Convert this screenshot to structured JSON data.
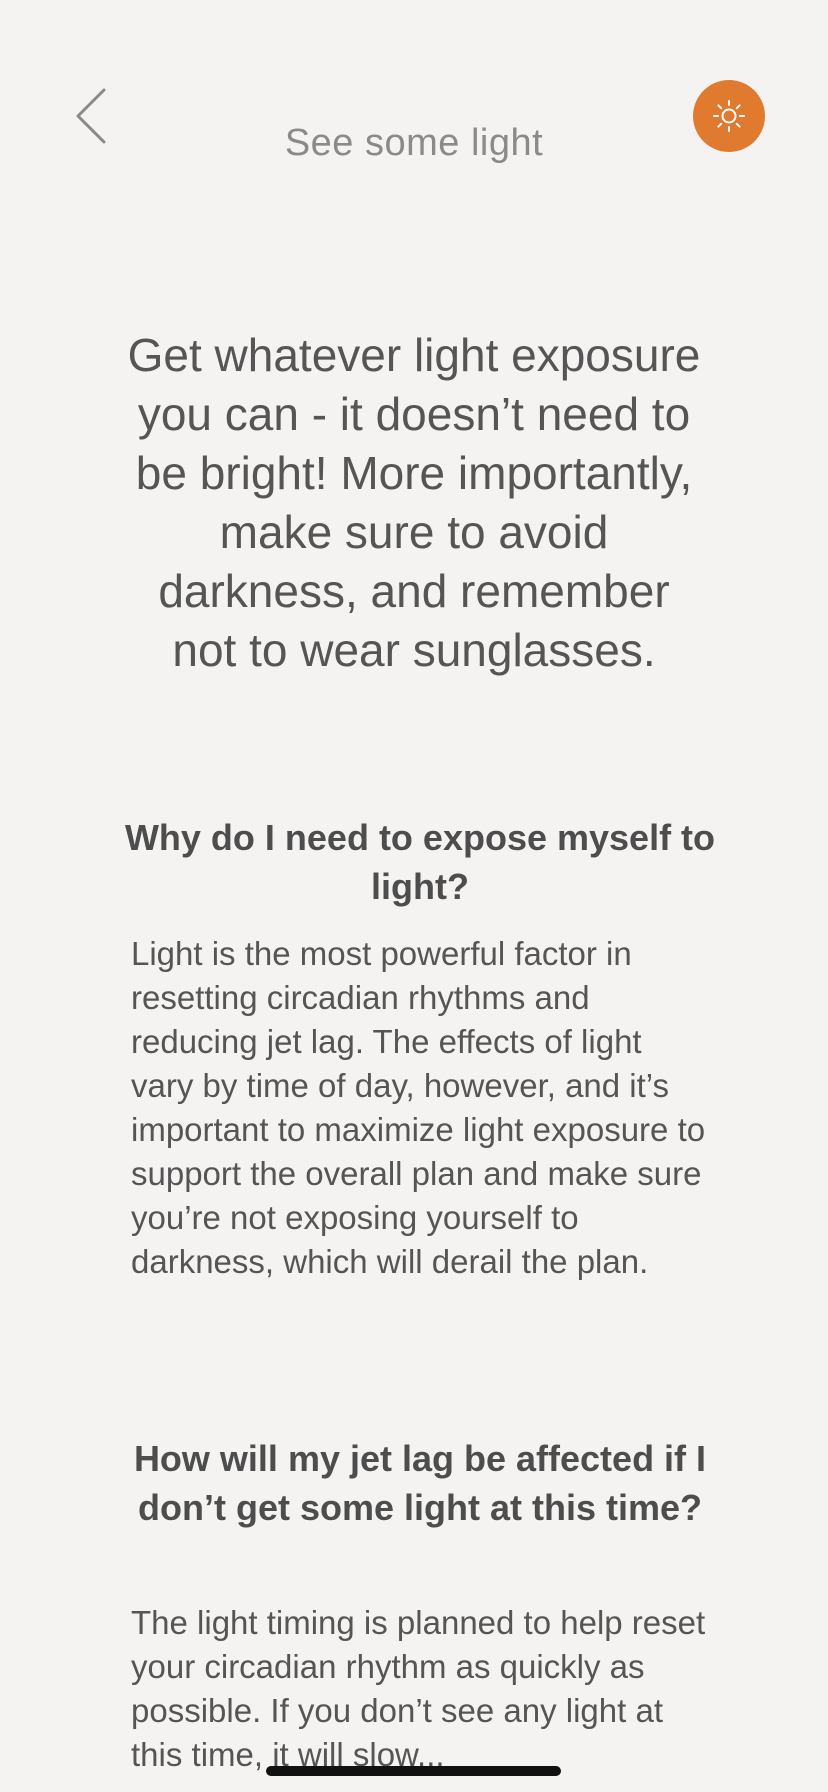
{
  "header": {
    "title": "See some light",
    "back_icon": "chevron-left-icon",
    "sun_icon": "sun-icon",
    "accent_color": "#e07a2f"
  },
  "main": {
    "lead": "Get whatever light exposure you can - it doesn’t need to be bright! More importantly, make sure to avoid darkness, and remember not to wear sunglasses.",
    "sections": [
      {
        "title": "Why do I need to expose myself to light?",
        "body": "Light is the most powerful factor in resetting circadian rhythms and reducing jet lag. The effects of light vary by time of day, however, and it’s important to maximize light exposure to support the overall plan and make sure you’re not exposing yourself to darkness, which will derail the plan."
      },
      {
        "title": "How will my jet lag be affected if I don’t get some light at this time?",
        "body": "The light timing is planned to help reset your circadian rhythm as quickly as possible. If you don’t see any light at this time, it will slow..."
      }
    ]
  }
}
